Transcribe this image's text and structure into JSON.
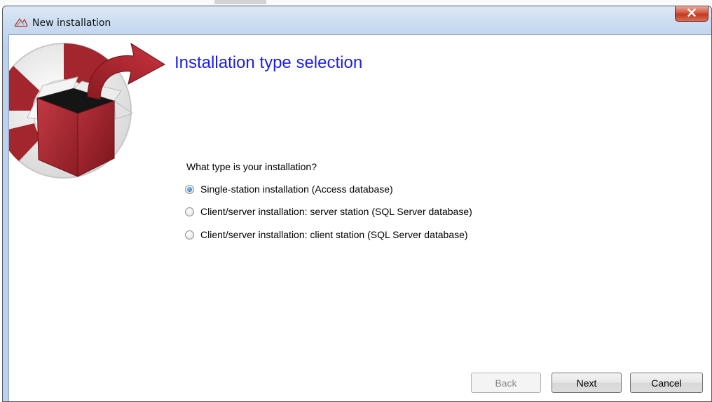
{
  "window": {
    "title": "New installation",
    "close_glyph": "x"
  },
  "wizard": {
    "heading": "Installation type selection",
    "question": "What type is your installation?",
    "options": [
      {
        "label": "Single-station installation (Access database)",
        "selected": true
      },
      {
        "label": "Client/server installation: server station (SQL Server database)",
        "selected": false
      },
      {
        "label": "Client/server installation: client station (SQL Server database)",
        "selected": false
      }
    ]
  },
  "buttons": {
    "back": "Back",
    "next": "Next",
    "cancel": "Cancel"
  },
  "icons": {
    "title": "installer-app-icon",
    "logo": "open-box-lifebuoy-logo",
    "close": "close-icon"
  },
  "colors": {
    "heading": "#1c1cf0",
    "close_button": "#c23a20",
    "logo_red": "#a3262e",
    "window_frame": "#bcd1ec"
  }
}
